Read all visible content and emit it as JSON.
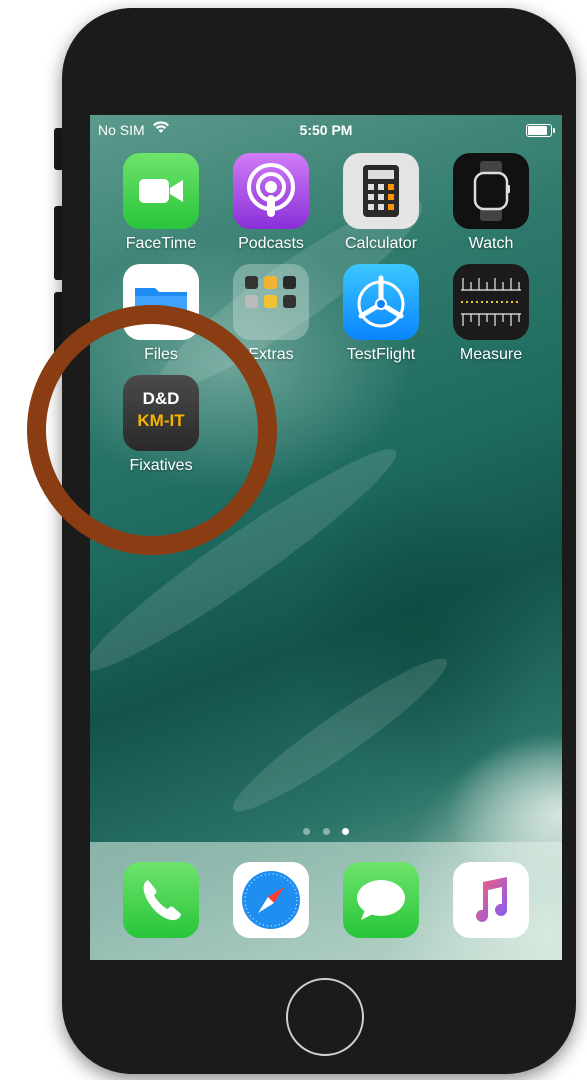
{
  "status_bar": {
    "carrier": "No SIM",
    "time": "5:50 PM",
    "battery_level": 1.0
  },
  "home_apps": [
    {
      "label": "FaceTime",
      "icon": "facetime-icon"
    },
    {
      "label": "Podcasts",
      "icon": "podcasts-icon"
    },
    {
      "label": "Calculator",
      "icon": "calculator-icon"
    },
    {
      "label": "Watch",
      "icon": "watch-icon"
    },
    {
      "label": "Files",
      "icon": "files-icon"
    },
    {
      "label": "Extras",
      "icon": "folder-icon"
    },
    {
      "label": "TestFlight",
      "icon": "testflight-icon"
    },
    {
      "label": "Measure",
      "icon": "measure-icon"
    },
    {
      "label": "Fixatives",
      "icon": "fixatives-app-icon",
      "icon_text_line1": "D&D",
      "icon_text_line2": "KM-IT"
    }
  ],
  "page_dots": {
    "count": 3,
    "active_index": 2
  },
  "dock_apps": [
    {
      "label": "Phone",
      "icon": "phone-icon"
    },
    {
      "label": "Safari",
      "icon": "safari-icon"
    },
    {
      "label": "Messages",
      "icon": "messages-icon"
    },
    {
      "label": "Music",
      "icon": "music-icon"
    }
  ],
  "colors": {
    "annotation_circle": "#8a3d12",
    "fixatives_text_top": "#ffffff",
    "fixatives_text_bottom": "#f4b400",
    "dock_background": "#e1f0e8"
  }
}
